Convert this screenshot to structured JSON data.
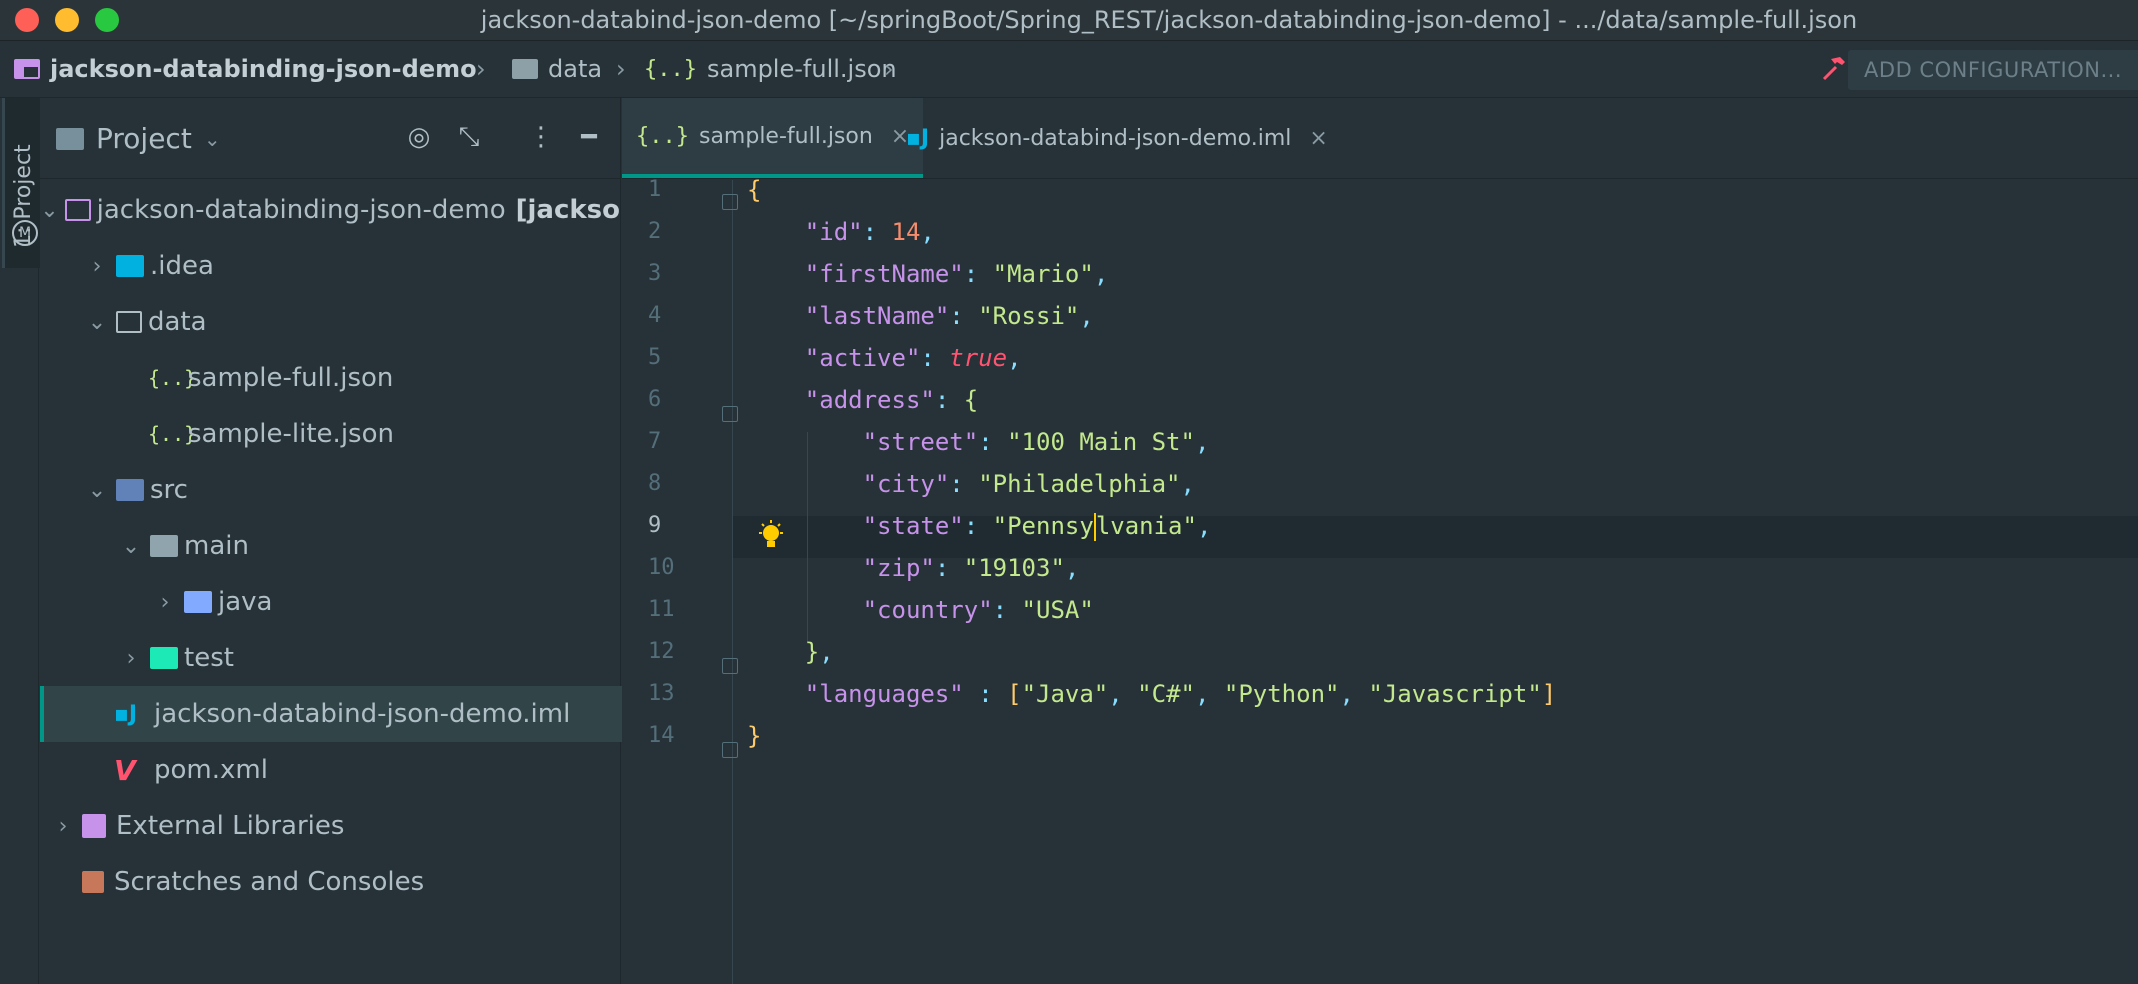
{
  "window": {
    "title": "jackson-databind-json-demo [~/springBoot/Spring_REST/jackson-databinding-json-demo] - .../data/sample-full.json"
  },
  "navbar": {
    "project": "jackson-databinding-json-demo",
    "folder": "data",
    "file": "sample-full.json",
    "add_config": "ADD CONFIGURATION..."
  },
  "stripe": {
    "label": "1: Project"
  },
  "panel": {
    "title": "Project",
    "tree": [
      {
        "label": "jackson-databinding-json-demo",
        "suffix": "[jackso",
        "icon": "project-folder-icon"
      },
      {
        "label": ".idea",
        "icon": "idea-folder-icon"
      },
      {
        "label": "data",
        "icon": "folder-icon"
      },
      {
        "label": "sample-full.json",
        "icon": "json-file-icon"
      },
      {
        "label": "sample-lite.json",
        "icon": "json-file-icon"
      },
      {
        "label": "src",
        "icon": "source-folder-icon"
      },
      {
        "label": "main",
        "icon": "folder-icon"
      },
      {
        "label": "java",
        "icon": "java-folder-icon"
      },
      {
        "label": "test",
        "icon": "test-folder-icon"
      },
      {
        "label": "jackson-databind-json-demo.iml",
        "icon": "iml-file-icon"
      },
      {
        "label": "pom.xml",
        "icon": "maven-icon"
      },
      {
        "label": "External Libraries",
        "icon": "library-icon"
      },
      {
        "label": "Scratches and Consoles",
        "icon": "scratches-icon"
      }
    ]
  },
  "tabs": [
    {
      "label": "sample-full.json",
      "icon_text": "{..}",
      "active": true
    },
    {
      "label": "jackson-databind-json-demo.iml",
      "icon_text": "",
      "active": false
    }
  ],
  "editor": {
    "current_line": 9,
    "line_numbers": [
      "1",
      "2",
      "3",
      "4",
      "5",
      "6",
      "7",
      "8",
      "9",
      "10",
      "11",
      "12",
      "13",
      "14"
    ],
    "lines": [
      [
        {
          "t": "{",
          "c": "br"
        }
      ],
      [
        {
          "t": "    "
        },
        {
          "t": "\"id\"",
          "c": "k"
        },
        {
          "t": ": ",
          "c": "p"
        },
        {
          "t": "14",
          "c": "n"
        },
        {
          "t": ",",
          "c": "p"
        }
      ],
      [
        {
          "t": "    "
        },
        {
          "t": "\"firstName\"",
          "c": "k"
        },
        {
          "t": ": ",
          "c": "p"
        },
        {
          "t": "\"Mario\"",
          "c": "s"
        },
        {
          "t": ",",
          "c": "p"
        }
      ],
      [
        {
          "t": "    "
        },
        {
          "t": "\"lastName\"",
          "c": "k"
        },
        {
          "t": ": ",
          "c": "p"
        },
        {
          "t": "\"Rossi\"",
          "c": "s"
        },
        {
          "t": ",",
          "c": "p"
        }
      ],
      [
        {
          "t": "    "
        },
        {
          "t": "\"active\"",
          "c": "k"
        },
        {
          "t": ": ",
          "c": "p"
        },
        {
          "t": "true",
          "c": "b"
        },
        {
          "t": ",",
          "c": "p"
        }
      ],
      [
        {
          "t": "    "
        },
        {
          "t": "\"address\"",
          "c": "k"
        },
        {
          "t": ": ",
          "c": "p"
        },
        {
          "t": "{",
          "c": "brg"
        }
      ],
      [
        {
          "t": "        "
        },
        {
          "t": "\"street\"",
          "c": "k"
        },
        {
          "t": ": ",
          "c": "p"
        },
        {
          "t": "\"100 Main St\"",
          "c": "s"
        },
        {
          "t": ",",
          "c": "p"
        }
      ],
      [
        {
          "t": "        "
        },
        {
          "t": "\"city\"",
          "c": "k"
        },
        {
          "t": ": ",
          "c": "p"
        },
        {
          "t": "\"Philadelphia\"",
          "c": "s"
        },
        {
          "t": ",",
          "c": "p"
        }
      ],
      [
        {
          "t": "        "
        },
        {
          "t": "\"state\"",
          "c": "k"
        },
        {
          "t": ": ",
          "c": "p"
        },
        {
          "t": "\"Pennsy",
          "c": "s"
        },
        {
          "t": "|",
          "c": "caret"
        },
        {
          "t": "lvania\"",
          "c": "s"
        },
        {
          "t": ",",
          "c": "p"
        }
      ],
      [
        {
          "t": "        "
        },
        {
          "t": "\"zip\"",
          "c": "k"
        },
        {
          "t": ": ",
          "c": "p"
        },
        {
          "t": "\"19103\"",
          "c": "s"
        },
        {
          "t": ",",
          "c": "p"
        }
      ],
      [
        {
          "t": "        "
        },
        {
          "t": "\"country\"",
          "c": "k"
        },
        {
          "t": ": ",
          "c": "p"
        },
        {
          "t": "\"USA\"",
          "c": "s"
        }
      ],
      [
        {
          "t": "    "
        },
        {
          "t": "}",
          "c": "brg"
        },
        {
          "t": ",",
          "c": "p"
        }
      ],
      [
        {
          "t": "    "
        },
        {
          "t": "\"languages\"",
          "c": "k"
        },
        {
          "t": " : ",
          "c": "p"
        },
        {
          "t": "[",
          "c": "br"
        },
        {
          "t": "\"Java\"",
          "c": "s"
        },
        {
          "t": ", ",
          "c": "p"
        },
        {
          "t": "\"C#\"",
          "c": "s"
        },
        {
          "t": ", ",
          "c": "p"
        },
        {
          "t": "\"Python\"",
          "c": "s"
        },
        {
          "t": ", ",
          "c": "p"
        },
        {
          "t": "\"Javascript\"",
          "c": "s"
        },
        {
          "t": "]",
          "c": "br"
        }
      ],
      [
        {
          "t": "}",
          "c": "br"
        }
      ]
    ]
  },
  "colors": {
    "background": "#263238",
    "accent": "#009688",
    "caret": "#ffcc00"
  }
}
